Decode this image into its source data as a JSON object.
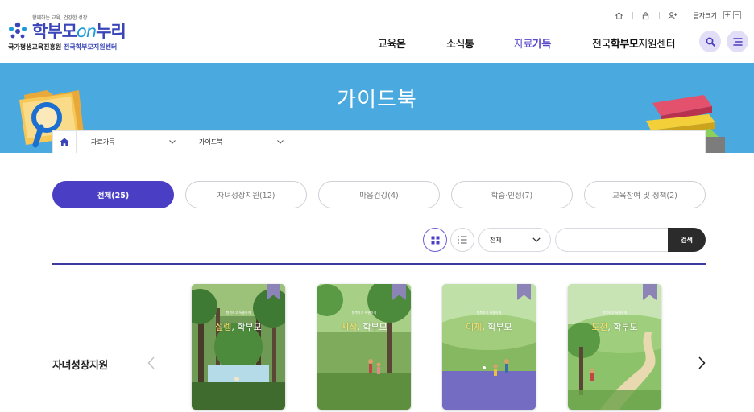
{
  "header": {
    "logo_tagline": "함께하는 교육, 건강한 성장",
    "logo_main_part1": "학부모",
    "logo_main_part2": "on",
    "logo_main_part3": "누리",
    "logo_org_part1": "국가평생교육진흥원",
    "logo_org_part2": "전국학부모지원센터",
    "util_home_icon": "home-icon",
    "util_lock_icon": "lock-icon",
    "util_join_icon": "user-plus-icon",
    "font_size_label": "글자크기",
    "font_plus": "+",
    "font_minus": "−",
    "nav": [
      {
        "part1": "교육",
        "part2": "온"
      },
      {
        "part1": "소식",
        "part2": "통"
      },
      {
        "part1": "자료",
        "part2": "가득"
      },
      {
        "part1": "전국",
        "part2": "학부모",
        "part3": "지원센터"
      }
    ],
    "search_icon": "search-icon",
    "menu_icon": "menu-icon"
  },
  "banner": {
    "title": "가이드북",
    "breadcrumb": {
      "home_icon": "home-icon",
      "level1": "자료가득",
      "level2": "가이드북"
    }
  },
  "filters": {
    "tabs": [
      {
        "label": "전체(25)",
        "active": true
      },
      {
        "label": "자녀성장지원(12)",
        "active": false
      },
      {
        "label": "마음건강(4)",
        "active": false
      },
      {
        "label": "학습·인성(7)",
        "active": false
      },
      {
        "label": "교육참여 및 정책(2)",
        "active": false
      }
    ]
  },
  "controls": {
    "grid_view_icon": "grid-view-icon",
    "list_view_icon": "list-view-icon",
    "select_value": "전체",
    "search_placeholder": "",
    "search_button": "검색"
  },
  "section": {
    "title": "자녀성장지원",
    "prev_icon": "chevron-left-icon",
    "next_icon": "chevron-right-icon",
    "books": [
      {
        "series": "행복하고 특별하게",
        "title_part1": "설렘",
        "title_part2": ", 학부모"
      },
      {
        "series": "행복하고 특별하게",
        "title_part1": "시작",
        "title_part2": ", 학부모"
      },
      {
        "series": "행복하고 특별하게",
        "title_part1": "이제",
        "title_part2": ", 학부모"
      },
      {
        "series": "행복하고 특별하게",
        "title_part1": "도전",
        "title_part2": ", 학부모"
      }
    ]
  },
  "colors": {
    "accent": "#4a3fc4",
    "banner": "#4aa9de",
    "brand": "#3a46b8"
  }
}
